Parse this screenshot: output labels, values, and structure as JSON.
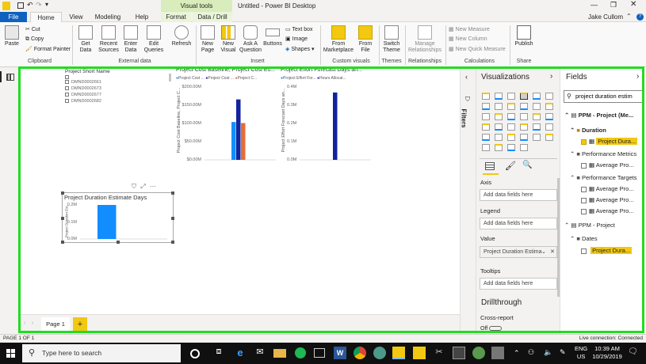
{
  "window": {
    "title": "Untitled - Power BI Desktop",
    "user": "Jake Cullom",
    "contextual_tab_group": "Visual tools"
  },
  "tabs": [
    {
      "label": "File"
    },
    {
      "label": "Home"
    },
    {
      "label": "View"
    },
    {
      "label": "Modeling"
    },
    {
      "label": "Help"
    },
    {
      "label": "Format"
    },
    {
      "label": "Data / Drill"
    }
  ],
  "ribbon": {
    "clipboard": {
      "paste": "Paste",
      "cut": "Cut",
      "copy": "Copy",
      "format_painter": "Format Painter",
      "group": "Clipboard"
    },
    "external": {
      "get_data": "Get Data",
      "recent": "Recent Sources",
      "enter": "Enter Data",
      "edit": "Edit Queries",
      "refresh": "Refresh",
      "group": "External data"
    },
    "insert": {
      "new_page": "New Page",
      "new_visual": "New Visual",
      "ask": "Ask A Question",
      "buttons": "Buttons",
      "text_box": "Text box",
      "image": "Image",
      "shapes": "Shapes",
      "group": "Insert"
    },
    "custom": {
      "marketplace": "From Marketplace",
      "file": "From File",
      "group": "Custom visuals"
    },
    "themes": {
      "switch": "Switch Theme",
      "group": "Themes"
    },
    "relationships": {
      "manage": "Manage Relationships",
      "group": "Relationships"
    },
    "calculations": {
      "new_measure": "New Measure",
      "new_column": "New Column",
      "new_quick": "New Quick Measure",
      "group": "Calculations"
    },
    "share": {
      "publish": "Publish",
      "group": "Share"
    }
  },
  "slicer": {
    "title": "Project Short Name",
    "items": [
      "DMND0002661",
      "DMND0002673",
      "DMND0002677",
      "DMND0002682"
    ]
  },
  "chart1": {
    "title": "Project Cost Baseline, Project Cost Es...",
    "legend": [
      "Project Cost ...",
      "Project Cost ...",
      "Project C..."
    ],
    "ylabel": "Project Cost Baseline, Project C...",
    "ticks": [
      "$200.00M",
      "$150.00M",
      "$100.00M",
      "$50.00M",
      "$0.00M"
    ]
  },
  "chart2": {
    "title": "Project Effort Forecast Days an...",
    "legend": [
      "Project Effort For...",
      "Hours Allocat..."
    ],
    "ylabel": "Project Effort Forecast Days an...",
    "ticks": [
      "0.4M",
      "0.3M",
      "0.2M",
      "0.1M",
      "0.0M"
    ]
  },
  "chart3": {
    "title": "Project Duration Estimate Days",
    "ylabel": "Project Duration Est...",
    "ticks": [
      "0.2M",
      "0.1M",
      "0.0M"
    ]
  },
  "chart_data": [
    {
      "type": "bar",
      "title": "Project Cost Baseline, Project Cost Es...",
      "ylabel": "Project Cost Baseline, Project C...",
      "ylim": [
        0,
        200
      ],
      "categories": [
        ""
      ],
      "series": [
        {
          "name": "Project Cost ...",
          "values": [
            104
          ],
          "color": "#118dff"
        },
        {
          "name": "Project Cost ...",
          "values": [
            166
          ],
          "color": "#12239e"
        },
        {
          "name": "Project C...",
          "values": [
            101
          ],
          "color": "#e66c37"
        }
      ]
    },
    {
      "type": "bar",
      "title": "Project Effort Forecast Days an...",
      "ylabel": "Project Effort Forecast Days an...",
      "ylim": [
        0,
        0.4
      ],
      "categories": [
        ""
      ],
      "series": [
        {
          "name": "Project Effort For...",
          "values": [
            0.0
          ],
          "color": "#118dff"
        },
        {
          "name": "Hours Allocat...",
          "values": [
            0.37
          ],
          "color": "#12239e"
        }
      ]
    },
    {
      "type": "bar",
      "title": "Project Duration Estimate Days",
      "ylabel": "Project Duration Est...",
      "ylim": [
        0,
        0.2
      ],
      "categories": [
        ""
      ],
      "series": [
        {
          "name": "",
          "values": [
            0.2
          ],
          "color": "#118dff"
        }
      ]
    }
  ],
  "filters_label": "Filters",
  "viz": {
    "title": "Visualizations",
    "wells": {
      "axis": "Axis",
      "axis_ph": "Add data fields here",
      "legend": "Legend",
      "legend_ph": "Add data fields here",
      "value": "Value",
      "value_field": "Project Duration Estima",
      "tooltips": "Tooltips",
      "tooltips_ph": "Add data fields here"
    },
    "drill": "Drillthrough",
    "cross": "Cross-report",
    "off": "Off"
  },
  "fields": {
    "title": "Fields",
    "search": "project duration estim",
    "table1": "PPM - Project (Me...",
    "folder_duration": "Duration",
    "field_duration": "Project Dura...",
    "folder_metrics": "Performance Metrics",
    "field_metric": "Average Pro...",
    "folder_targets": "Performance Targets",
    "field_t1": "Average Pro...",
    "field_t2": "Average Pro...",
    "field_t3": "Average Pro...",
    "table2": "PPM - Project",
    "folder_dates": "Dates",
    "field_dates": "Project Dura..."
  },
  "page_tab": "Page 1",
  "status": {
    "left": "PAGE 1 OF 1",
    "right": "Live connection: Connected"
  },
  "taskbar": {
    "search": "Type here to search",
    "lang1": "ENG",
    "lang2": "US",
    "time": "10:39 AM",
    "date": "10/29/2019"
  }
}
